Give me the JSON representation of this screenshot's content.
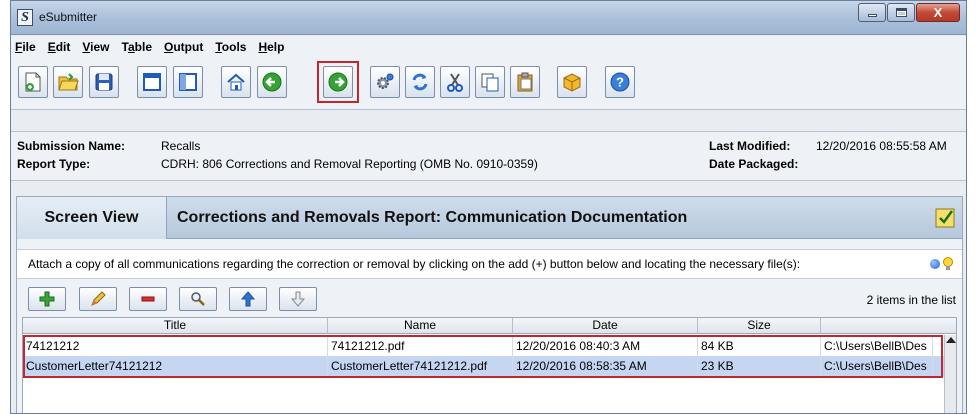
{
  "window": {
    "title": "eSubmitter",
    "app_icon_letter": "S",
    "close_label": "X"
  },
  "menu": [
    {
      "pre": "",
      "u": "F",
      "post": "ile"
    },
    {
      "pre": "",
      "u": "E",
      "post": "dit"
    },
    {
      "pre": "",
      "u": "V",
      "post": "iew"
    },
    {
      "pre": "T",
      "u": "a",
      "post": "ble"
    },
    {
      "pre": "",
      "u": "O",
      "post": "utput"
    },
    {
      "pre": "",
      "u": "T",
      "post": "ools"
    },
    {
      "pre": "",
      "u": "H",
      "post": "elp"
    }
  ],
  "toolbar_icons": [
    "new-submission-icon",
    "open-folder-icon",
    "save-disk-icon",
    "single-pane-icon",
    "split-pane-icon",
    "home-icon",
    "back-arrow-icon",
    "forward-arrow-icon",
    "settings-gears-icon",
    "refresh-icon",
    "cut-scissors-icon",
    "copy-icon",
    "paste-clipboard-icon",
    "package-box-icon",
    "help-icon"
  ],
  "submission": {
    "name_label": "Submission Name:",
    "name_value": "Recalls",
    "type_label": "Report Type:",
    "type_value": "CDRH: 806 Corrections and Removal Reporting (OMB No. 0910-0359)",
    "modified_label": "Last Modified:",
    "modified_value": "12/20/2016 08:55:58 AM",
    "packaged_label": "Date Packaged:",
    "packaged_value": ""
  },
  "panel": {
    "screen_view_label": "Screen View",
    "title": "Corrections and Removals Report: Communication Documentation",
    "instructions": "Attach a copy of all communications regarding the correction or removal by clicking on the add (+) button below and locating the necessary file(s):",
    "item_count": "2 items in the list"
  },
  "list_buttons": [
    "add-icon",
    "edit-pencil-icon",
    "remove-icon",
    "view-magnifier-icon",
    "move-up-icon",
    "move-down-icon"
  ],
  "table": {
    "columns": [
      "Title",
      "Name",
      "Date",
      "Size",
      ""
    ],
    "rows": [
      {
        "title": "74121212",
        "name": "74121212.pdf",
        "date": "12/20/2016 08:40:3 AM",
        "size": "84 KB",
        "path": "C:\\Users\\BellB\\Des"
      },
      {
        "title": "CustomerLetter74121212",
        "name": "CustomerLetter74121212.pdf",
        "date": "12/20/2016 08:58:35 AM",
        "size": "23 KB",
        "path": "C:\\Users\\BellB\\Des"
      }
    ]
  },
  "colors": {
    "highlight": "#c0282d",
    "selected_row": "#c4d6f2"
  }
}
